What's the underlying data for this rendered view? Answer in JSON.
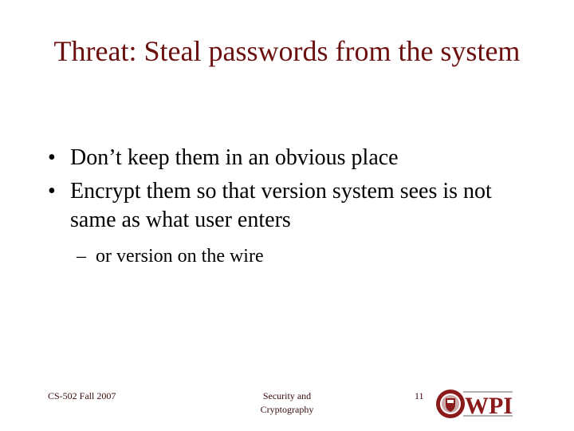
{
  "slide": {
    "title": "Threat: Steal passwords from the system",
    "bullets": [
      {
        "marker": "•",
        "text": "Don’t keep them in an obvious place"
      },
      {
        "marker": "•",
        "text": "Encrypt them so that version system sees is not same as what user enters"
      }
    ],
    "sub_bullets": [
      {
        "marker": "–",
        "text": "or version on the wire"
      }
    ]
  },
  "footer": {
    "left": "CS-502 Fall 2007",
    "center_line1": "Security and",
    "center_line2": "Cryptography",
    "page_number": "11",
    "logo_text": "WPI"
  },
  "colors": {
    "title": "#6b0f0f",
    "logo": "#8b1a1a"
  }
}
